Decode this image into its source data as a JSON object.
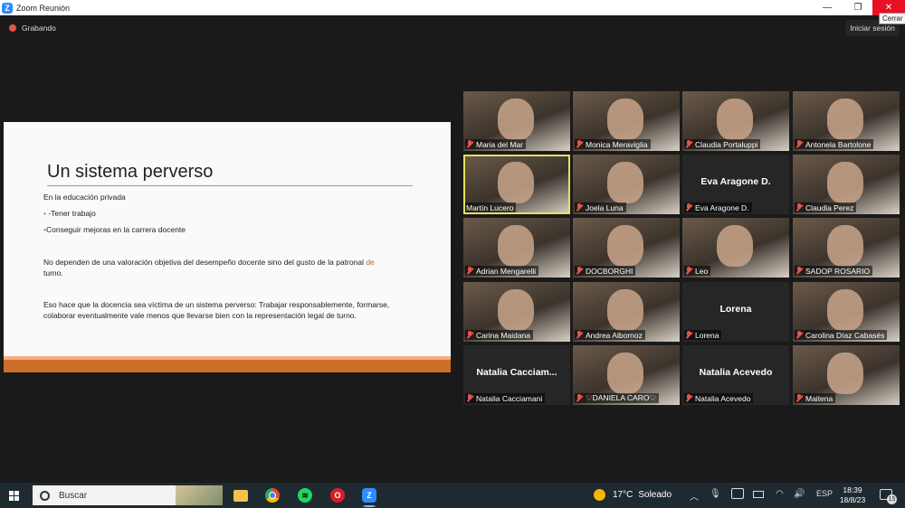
{
  "window": {
    "app_icon": "zoom-icon",
    "title": "Zoom Reunión",
    "min_glyph": "—",
    "max_glyph": "❐",
    "close_glyph": "✕",
    "close_tooltip": "Cerrar"
  },
  "meeting": {
    "recording_label": "Grabando",
    "signin_label": "Iniciar sesión"
  },
  "slide": {
    "title": "Un sistema perverso",
    "line1": "En la educación privada",
    "bullet_glyph": "•",
    "line2": " -Tener trabajo",
    "line3": "Conseguir mejoras en la carrera docente",
    "line4a": "No dependen de una valoración objetiva del desempeño docente sino del gusto de la patronal",
    "line4b": " de",
    "line4c": "turno.",
    "line5": "Eso hace que la docencia sea víctima de un sistema perverso: Trabajar responsablemente, formarse, colaborar eventualmente vale menos que llevarse bien con la representación legal de turno."
  },
  "participants": [
    {
      "name": "Maria del Mar",
      "video": true,
      "muted": true
    },
    {
      "name": "Monica Meraviglia",
      "video": true,
      "muted": true
    },
    {
      "name": "Claudia Portaluppi",
      "video": true,
      "muted": true
    },
    {
      "name": "Antonela Bartolone",
      "video": true,
      "muted": true
    },
    {
      "name": "Martín Lucero",
      "video": true,
      "muted": false,
      "active_speaker": true
    },
    {
      "name": "Joela Luna",
      "video": true,
      "muted": true
    },
    {
      "name": "Eva Aragone D.",
      "display_name": "Eva Aragone D.",
      "video": false,
      "muted": true
    },
    {
      "name": "Claudia Perez",
      "video": true,
      "muted": true
    },
    {
      "name": "Adrian Mengarelli",
      "video": true,
      "muted": true
    },
    {
      "name": "DOCBORGHI",
      "video": true,
      "muted": true
    },
    {
      "name": "Leo",
      "video": true,
      "muted": true
    },
    {
      "name": "SADOP ROSARIO",
      "video": true,
      "muted": true
    },
    {
      "name": "Carina Maidana",
      "video": true,
      "muted": true
    },
    {
      "name": "Andrea Albornoz",
      "video": true,
      "muted": true
    },
    {
      "name": "Lorena",
      "display_name": "Lorena",
      "video": false,
      "muted": true
    },
    {
      "name": "Carolina Díaz Cabasés",
      "video": true,
      "muted": true
    },
    {
      "name": "Natalia Cacciamani",
      "display_name": "Natalia  Cacciam...",
      "video": false,
      "muted": true
    },
    {
      "name": "♡DANIELA CARO♡",
      "video": true,
      "muted": true
    },
    {
      "name": "Natalia Acevedo",
      "display_name": "Natalia Acevedo",
      "video": false,
      "muted": true
    },
    {
      "name": "Maitena",
      "video": true,
      "muted": true
    }
  ],
  "taskbar": {
    "search_placeholder": "Buscar",
    "pinned_apps": [
      "file-explorer-icon",
      "chrome-icon",
      "spotify-icon",
      "opera-icon",
      "zoom-icon"
    ],
    "weather_temp": "17°C",
    "weather_condition": "Soleado",
    "language": "ESP",
    "time": "18:39",
    "date": "18/8/23",
    "notification_count": "15",
    "tray_glyphs": {
      "chevron": "︿",
      "mic": "🎙",
      "wifi": "◠",
      "volume": "🔊"
    }
  }
}
